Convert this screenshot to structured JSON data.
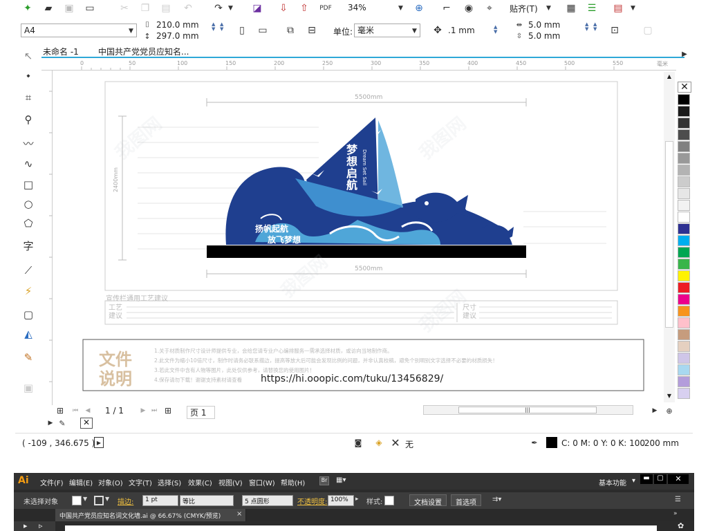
{
  "toolbar_top": {
    "zoom": "34%",
    "snap_label": "贴齐(T)"
  },
  "property_bar": {
    "page_size": "A4",
    "width": "210.0 mm",
    "height": "297.0 mm",
    "units_label": "单位:",
    "units_value": "毫米",
    "nudge": ".1 mm",
    "dup_x": "5.0 mm",
    "dup_y": "5.0 mm"
  },
  "doc_tabs": [
    "未命名 -1",
    "中国共产党党员应知名..."
  ],
  "ruler_h": [
    "0",
    "50",
    "100",
    "150",
    "200",
    "250",
    "300",
    "350",
    "400",
    "450",
    "500",
    "550"
  ],
  "ruler_unit": "毫米",
  "artwork": {
    "dim_top": "5500mm",
    "dim_bottom": "5500mm",
    "dim_side": "2400mm",
    "sail_title": "梦想启航",
    "sail_sub": "Dream Set Sail",
    "wave_line1": "扬帆起航",
    "wave_line2": "放飞梦想",
    "section_title": "宣传栏通用工艺建议",
    "box_left_label": "工艺建议",
    "box_right_label": "尺寸建议",
    "file_title_1": "文件",
    "file_title_2": "说明",
    "file_lines": [
      "1.关于材质制作尺寸设计师提供专业，会给您请专业户心编排服务一需承选择材质，或访向当地制作商。",
      "2.此文件为缩小10倍尺寸，制作时请务必联系描边，提高等放大后可能会发现比例的问题，并非认真校稿，避免个别明别文字选择不必要的材质损失！",
      "3.若此文件中含有人物等图片，此处仅供参考，请替换您的使用图片！",
      "4.保存请勿下载！谢谢支持素材请查看"
    ],
    "url": "https://hi.ooopic.com/tuku/13456829/"
  },
  "nav": {
    "page_counter": "1 / 1",
    "page_tab": "页 1"
  },
  "status": {
    "coords": "( -109 , 346.675 )",
    "fill_label": "无",
    "color_values": "C: 0 M: 0 Y: 0 K: 100",
    "stroke_width": ".200 mm"
  },
  "illustrator": {
    "logo": "Ai",
    "menus": [
      "文件(F)",
      "编辑(E)",
      "对象(O)",
      "文字(T)",
      "选择(S)",
      "效果(C)",
      "视图(V)",
      "窗口(W)",
      "帮助(H)"
    ],
    "workspace": "基本功能",
    "no_selection": "未选择对象",
    "stroke_label": "描边:",
    "stroke_value": "1 pt",
    "stroke_style": "等比",
    "brush": "5 点圆形",
    "opacity_label": "不透明度:",
    "opacity_value": "100%",
    "style_label": "样式:",
    "doc_setup": "文档设置",
    "preferences": "首选项",
    "doc_tab": "中国共产党员应知名词文化墙.ai @ 66.67% (CMYK/预览)",
    "tab_close": "×"
  },
  "palette_colors": [
    "#000000",
    "#1a1a1a",
    "#333333",
    "#4d4d4d",
    "#808080",
    "#999999",
    "#b3b3b3",
    "#cccccc",
    "#e6e6e6",
    "#f2f2f2",
    "#ffffff",
    "#2e3192",
    "#00aeef",
    "#00a651",
    "#39b54a",
    "#fff200",
    "#ed1c24",
    "#ec008c",
    "#f7941d",
    "#ffc0cb",
    "#c69c7d",
    "#e5d0c0",
    "#cfc6e8",
    "#a8d8f0",
    "#b39ddb",
    "#d8d0f0"
  ]
}
